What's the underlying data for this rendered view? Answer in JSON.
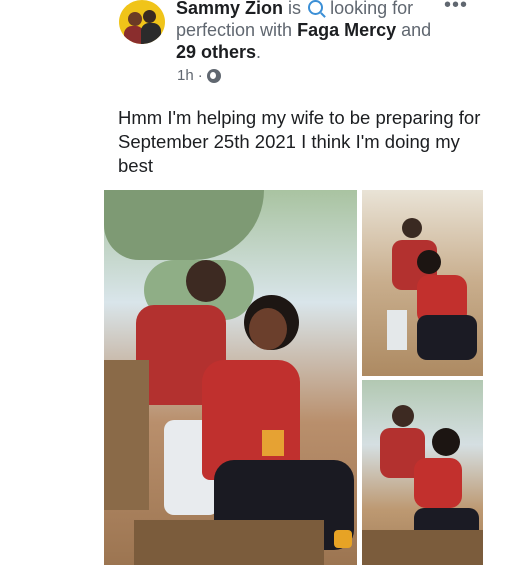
{
  "post": {
    "author": "Sammy Zion",
    "status_pre": "is",
    "status_mid": "looking for perfection with",
    "tagged": "Faga Mercy",
    "and": "and",
    "others": "29 others",
    "period": ".",
    "time": "1h",
    "separator": "·",
    "privacy_icon": "globe-icon",
    "text": "Hmm I'm helping my wife to be preparing for September 25th 2021 I think I'm doing my best"
  },
  "icons": {
    "more": "more-options-icon",
    "activity": "magnifier-icon"
  },
  "colors": {
    "avatar_bg": "#f0c419",
    "secondary_text": "#606770",
    "primary_text": "#1c1e21"
  }
}
